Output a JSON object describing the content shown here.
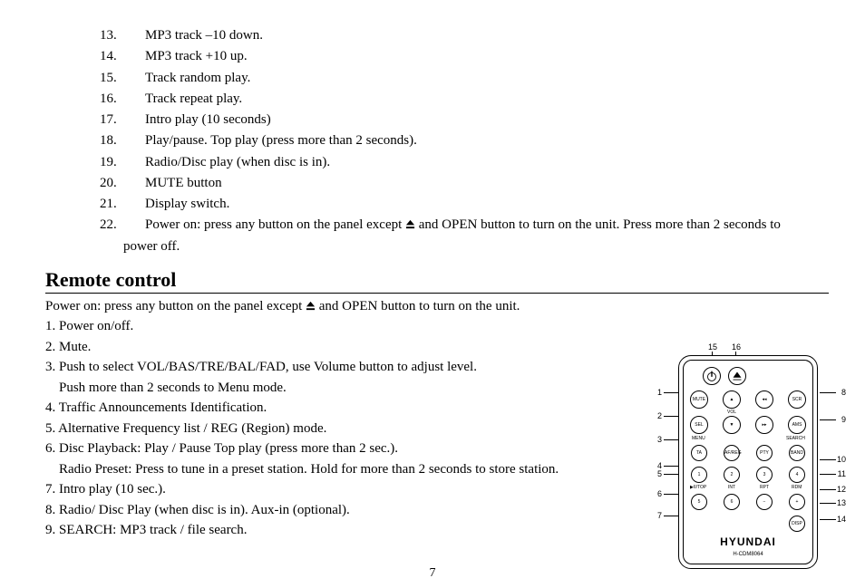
{
  "upper_list": [
    {
      "num": "13.",
      "text": "MP3 track –10 down."
    },
    {
      "num": "14.",
      "text": "MP3 track +10 up."
    },
    {
      "num": "15.",
      "text": "Track random play."
    },
    {
      "num": "16.",
      "text": "Track repeat play."
    },
    {
      "num": "17.",
      "text": "Intro play (10 seconds)"
    },
    {
      "num": "18.",
      "text": "Play/pause. Top play (press more than 2 seconds)."
    },
    {
      "num": "19.",
      "text": "Radio/Disc play (when disc is in)."
    },
    {
      "num": "20.",
      "text": "MUTE button"
    },
    {
      "num": "21.",
      "text": "Display switch."
    }
  ],
  "item22": {
    "num": "22.",
    "before": "Power on: press any button on the panel except ",
    "after": " and OPEN button to turn on the unit. Press more than 2 seconds to",
    "wrap": "power off."
  },
  "heading": "Remote control",
  "intro": {
    "before": "Power on: press any button on the panel except ",
    "after": " and OPEN button to turn on the unit."
  },
  "lower_list": [
    "1. Power on/off.",
    "2. Mute.",
    "3. Push to select VOL/BAS/TRE/BAL/FAD, use Volume button to adjust level."
  ],
  "lower_sub1": "Push more than 2 seconds to Menu mode.",
  "lower_list2": [
    "4. Traffic Announcements Identification.",
    "5. Alternative Frequency list / REG (Region) mode.",
    "6. Disc Playback: Play / Pause Top play (press more than 2 sec.)."
  ],
  "lower_sub2": "Radio Preset: Press to tune in a preset station. Hold for more than 2 seconds to store station.",
  "lower_list3": [
    "7. Intro play (10 sec.).",
    "8. Radio/ Disc Play (when disc is in). Aux-in (optional).",
    "9. SEARCH: MP3 track / file search."
  ],
  "page_number": "7",
  "remote": {
    "brand": "HYUNDAI",
    "model": "H-CDM8064",
    "buttons": {
      "mute": "MUTE",
      "scr": "SCR",
      "sel": "SEL",
      "ams": "AMS",
      "ta": "TA",
      "afreg": "AF/REG",
      "pty": "PTY",
      "band": "BAND",
      "p1": "1",
      "p2": "2",
      "p3": "3",
      "p4": "4",
      "p5": "5",
      "p6": "6",
      "disp": "DISP"
    },
    "small_labels": {
      "vol": "VOL",
      "menu": "MENU",
      "search": "SEARCH",
      "top": "▶II/TOP",
      "int": "INT",
      "rpt": "RPT",
      "rdm": "RDM"
    },
    "callouts": {
      "c1": "1",
      "c2": "2",
      "c3": "3",
      "c4": "4",
      "c5": "5",
      "c6": "6",
      "c7": "7",
      "c8": "8",
      "c9": "9",
      "c10": "10",
      "c11": "11",
      "c12": "12",
      "c13": "13",
      "c14": "14",
      "c15": "15",
      "c16": "16"
    }
  }
}
